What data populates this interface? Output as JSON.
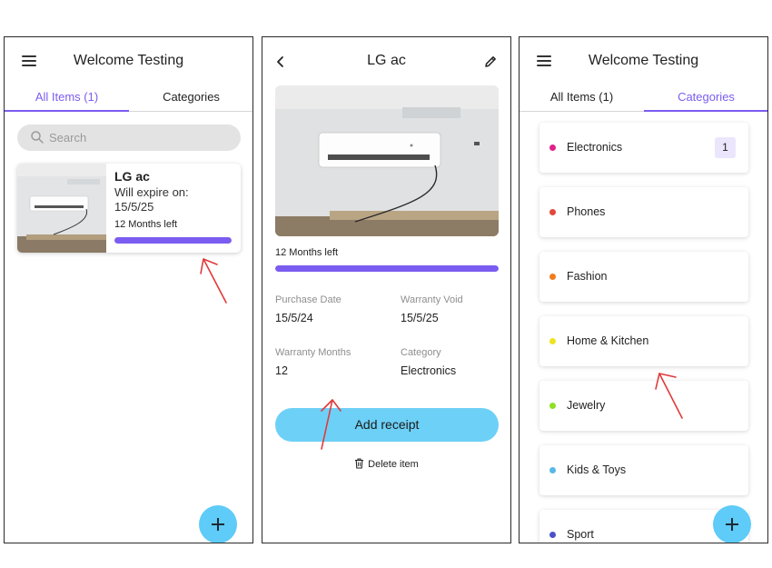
{
  "screen1": {
    "title": "Welcome Testing",
    "tabs": [
      {
        "label": "All Items (1)",
        "active": true
      },
      {
        "label": "Categories",
        "active": false
      }
    ],
    "search_placeholder": "Search",
    "items": [
      {
        "name": "LG ac",
        "expire_label": "Will expire on:",
        "expire_date": "15/5/25",
        "months_left": "12 Months left",
        "progress": 1.0
      }
    ],
    "fab_icon": "plus-icon"
  },
  "screen2": {
    "title": "LG ac",
    "back_icon": "chevron-left-icon",
    "edit_icon": "pencil-icon",
    "months_left": "12 Months left",
    "progress": 1.0,
    "details": {
      "purchase_date_label": "Purchase Date",
      "purchase_date": "15/5/24",
      "warranty_void_label": "Warranty Void",
      "warranty_void": "15/5/25",
      "warranty_months_label": "Warranty Months",
      "warranty_months": "12",
      "category_label": "Category",
      "category": "Electronics"
    },
    "add_receipt_label": "Add receipt",
    "delete_label": "Delete item"
  },
  "screen3": {
    "title": "Welcome Testing",
    "tabs": [
      {
        "label": "All Items (1)",
        "active": false
      },
      {
        "label": "Categories",
        "active": true
      }
    ],
    "categories": [
      {
        "name": "Electronics",
        "color": "#e0218a",
        "count": "1"
      },
      {
        "name": "Phones",
        "color": "#e0483a"
      },
      {
        "name": "Fashion",
        "color": "#f07c1e"
      },
      {
        "name": "Home & Kitchen",
        "color": "#eee321"
      },
      {
        "name": "Jewelry",
        "color": "#8fe022"
      },
      {
        "name": "Kids & Toys",
        "color": "#55b8e8"
      },
      {
        "name": "Sport",
        "color": "#4a52c9"
      }
    ]
  },
  "colors": {
    "accent": "#7b5cf0",
    "progress_track": "#e4dcfc",
    "primary_button": "#6dd0f7",
    "fab": "#5ecbf8",
    "annotation": "#e03a3a"
  }
}
